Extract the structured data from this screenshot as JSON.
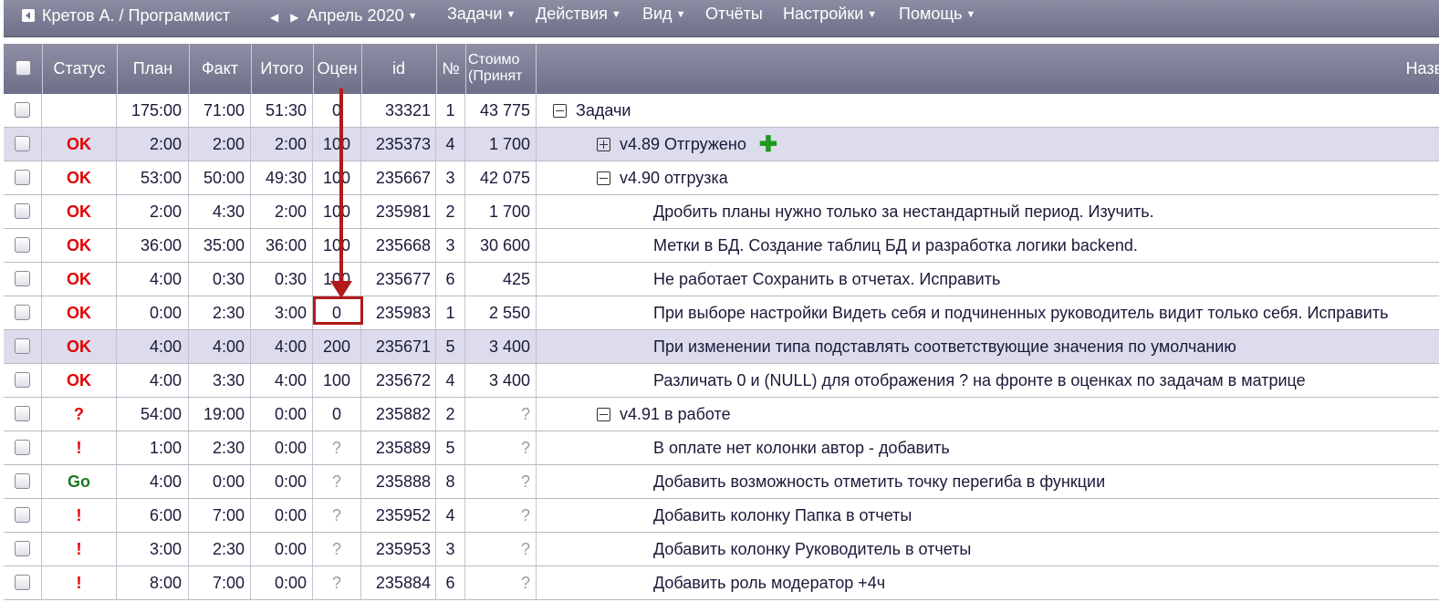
{
  "menu": {
    "user": "Кретов А. / Программист",
    "period": "Апрель 2020",
    "tasks": "Задачи",
    "actions": "Действия",
    "view": "Вид",
    "reports": "Отчёты",
    "settings": "Настройки",
    "help": "Помощь"
  },
  "columns": {
    "status": "Статус",
    "plan": "План",
    "fact": "Факт",
    "total": "Итого",
    "estimate": "Оцен",
    "id": "id",
    "num": "№",
    "cost1": "Стоимо",
    "cost2": "(Принят",
    "name": "Назва"
  },
  "rows": [
    {
      "status": "",
      "plan": "175:00",
      "fact": "71:00",
      "total": "51:30",
      "est": "0",
      "id": "33321",
      "num": "1",
      "cost": "43 775",
      "name": "Задачи"
    },
    {
      "status": "OK",
      "plan": "2:00",
      "fact": "2:00",
      "total": "2:00",
      "est": "100",
      "id": "235373",
      "num": "4",
      "cost": "1 700",
      "name": "v4.89 Отгружено"
    },
    {
      "status": "OK",
      "plan": "53:00",
      "fact": "50:00",
      "total": "49:30",
      "est": "100",
      "id": "235667",
      "num": "3",
      "cost": "42 075",
      "name": "v4.90 отгрузка"
    },
    {
      "status": "OK",
      "plan": "2:00",
      "fact": "4:30",
      "total": "2:00",
      "est": "100",
      "id": "235981",
      "num": "2",
      "cost": "1 700",
      "name": "Дробить планы нужно только за нестандартный период. Изучить."
    },
    {
      "status": "OK",
      "plan": "36:00",
      "fact": "35:00",
      "total": "36:00",
      "est": "100",
      "id": "235668",
      "num": "3",
      "cost": "30 600",
      "name": "Метки в БД. Создание таблиц БД и разработка логики backend."
    },
    {
      "status": "OK",
      "plan": "4:00",
      "fact": "0:30",
      "total": "0:30",
      "est": "100",
      "id": "235677",
      "num": "6",
      "cost": "425",
      "name": "Не работает Сохранить в отчетах. Исправить"
    },
    {
      "status": "OK",
      "plan": "0:00",
      "fact": "2:30",
      "total": "3:00",
      "est": "0",
      "id": "235983",
      "num": "1",
      "cost": "2 550",
      "name": "При выборе настройки Видеть себя и подчиненных руководитель видит только себя. Исправить"
    },
    {
      "status": "OK",
      "plan": "4:00",
      "fact": "4:00",
      "total": "4:00",
      "est": "200",
      "id": "235671",
      "num": "5",
      "cost": "3 400",
      "name": "При изменении типа подставлять соответствующие значения по умолчанию"
    },
    {
      "status": "OK",
      "plan": "4:00",
      "fact": "3:30",
      "total": "4:00",
      "est": "100",
      "id": "235672",
      "num": "4",
      "cost": "3 400",
      "name": "Различать 0 и (NULL) для отображения ? на фронте в оценках по задачам в матрице"
    },
    {
      "status": "?",
      "plan": "54:00",
      "fact": "19:00",
      "total": "0:00",
      "est": "0",
      "id": "235882",
      "num": "2",
      "cost": "?",
      "name": "v4.91 в работе"
    },
    {
      "status": "!",
      "plan": "1:00",
      "fact": "2:30",
      "total": "0:00",
      "est": "?",
      "id": "235889",
      "num": "5",
      "cost": "?",
      "name": "В оплате нет колонки автор - добавить"
    },
    {
      "status": "Go",
      "plan": "4:00",
      "fact": "0:00",
      "total": "0:00",
      "est": "?",
      "id": "235888",
      "num": "8",
      "cost": "?",
      "name": "Добавить возможность отметить точку перегиба в функции"
    },
    {
      "status": "!",
      "plan": "6:00",
      "fact": "7:00",
      "total": "0:00",
      "est": "?",
      "id": "235952",
      "num": "4",
      "cost": "?",
      "name": "Добавить колонку Папка в отчеты"
    },
    {
      "status": "!",
      "plan": "3:00",
      "fact": "2:30",
      "total": "0:00",
      "est": "?",
      "id": "235953",
      "num": "3",
      "cost": "?",
      "name": "Добавить колонку Руководитель в отчеты"
    },
    {
      "status": "!",
      "plan": "8:00",
      "fact": "7:00",
      "total": "0:00",
      "est": "?",
      "id": "235884",
      "num": "6",
      "cost": "?",
      "name": "Добавить роль модератор +4ч"
    }
  ]
}
